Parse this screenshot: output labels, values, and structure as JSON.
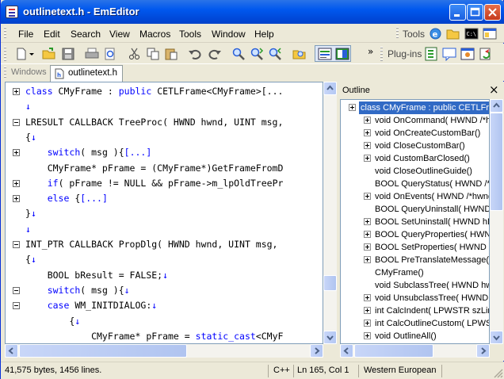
{
  "window": {
    "title": "outlinetext.h - EmEditor"
  },
  "menu": [
    "File",
    "Edit",
    "Search",
    "View",
    "Macros",
    "Tools",
    "Window",
    "Help"
  ],
  "toolbars": {
    "tools_label": "Tools",
    "plugins_label": "Plug-ins",
    "more_glyph": "»"
  },
  "tabs": {
    "windows_label": "Windows",
    "active_tab": "outlinetext.h"
  },
  "editor": {
    "lines": [
      {
        "fold": "plus",
        "text": "class CMyFrame : public CETLFrame<CMyFrame>[..."
      },
      {
        "fold": "",
        "text": "↓"
      },
      {
        "fold": "minus",
        "text": "LRESULT CALLBACK TreeProc( HWND hwnd, UINT msg,"
      },
      {
        "fold": "",
        "text": "{↓"
      },
      {
        "fold": "plus",
        "text": "    switch( msg ){[...]"
      },
      {
        "fold": "",
        "text": "    CMyFrame* pFrame = (CMyFrame*)GetFrameFromD"
      },
      {
        "fold": "plus",
        "text": "    if( pFrame != NULL && pFrame->m_lpOldTreePr"
      },
      {
        "fold": "plus",
        "text": "    else {[...]"
      },
      {
        "fold": "",
        "text": "}↓"
      },
      {
        "fold": "",
        "text": "↓"
      },
      {
        "fold": "minus",
        "text": "INT_PTR CALLBACK PropDlg( HWND hwnd, UINT msg, "
      },
      {
        "fold": "",
        "text": "{↓"
      },
      {
        "fold": "",
        "text": "    BOOL bResult = FALSE;↓"
      },
      {
        "fold": "minus",
        "text": "    switch( msg ){↓"
      },
      {
        "fold": "minus",
        "text": "    case WM_INITDIALOG:↓"
      },
      {
        "fold": "",
        "text": "        {↓"
      },
      {
        "fold": "",
        "text": "            CMyFrame* pFrame = static_cast<CMyF"
      }
    ]
  },
  "outline": {
    "title": "Outline",
    "close_glyph": "×",
    "root": "class CMyFrame : public CETLFrame",
    "items": [
      {
        "box": true,
        "text": "void OnCommand( HWND /*hw"
      },
      {
        "box": true,
        "text": "void OnCreateCustomBar()"
      },
      {
        "box": true,
        "text": "void CloseCustomBar()"
      },
      {
        "box": true,
        "text": "void CustomBarClosed()"
      },
      {
        "box": false,
        "text": "void CloseOutlineGuide()"
      },
      {
        "box": false,
        "text": "BOOL QueryStatus( HWND /*"
      },
      {
        "box": true,
        "text": "void OnEvents( HWND /*hwnd"
      },
      {
        "box": false,
        "text": "BOOL QueryUninstall( HWND h"
      },
      {
        "box": true,
        "text": "BOOL SetUninstall( HWND hDl"
      },
      {
        "box": true,
        "text": "BOOL QueryProperties( HWND"
      },
      {
        "box": true,
        "text": "BOOL SetProperties( HWND h"
      },
      {
        "box": true,
        "text": "BOOL PreTranslateMessage( H"
      },
      {
        "box": false,
        "text": "CMyFrame()"
      },
      {
        "box": false,
        "text": "void SubclassTree( HWND hwr"
      },
      {
        "box": true,
        "text": "void UnsubclassTree( HWND h"
      },
      {
        "box": true,
        "text": "int CalcIndent( LPWSTR szLine"
      },
      {
        "box": true,
        "text": "int CalcOutlineCustom( LPWST"
      },
      {
        "box": true,
        "text": "void OutlineAll()"
      }
    ]
  },
  "status": {
    "info": "41,575 bytes, 1456 lines.",
    "language": "C++",
    "position": "Ln 165, Col 1",
    "encoding": "Western European"
  },
  "colors": {
    "keyword": "#0000ff",
    "title_bar": "#0054e3",
    "selection": "#316ac5"
  }
}
